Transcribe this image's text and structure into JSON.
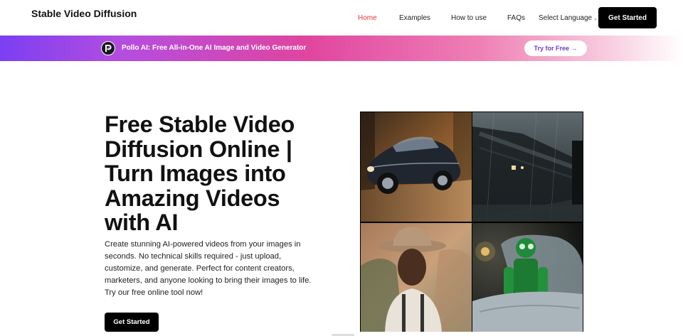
{
  "header": {
    "logo": "Stable Video Diffusion",
    "nav": [
      {
        "label": "Home",
        "active": true
      },
      {
        "label": "Examples",
        "active": false
      },
      {
        "label": "How to use",
        "active": false
      },
      {
        "label": "FAQs",
        "active": false
      }
    ],
    "language_label": "Select Language",
    "cta_label": "Get Started"
  },
  "banner": {
    "text": "Pollo AI: Free All-in-One AI Image and Video Generator",
    "button_label": "Try for Free →",
    "logo_letter": "P"
  },
  "hero": {
    "title": "Free Stable Video Diffusion Online | Turn Images into Amazing Videos with AI",
    "description": "Create stunning AI-powered videos from your images in seconds. No technical skills required - just upload, customize, and generate. Perfect for content creators, marketers, and anyone looking to bring their images to life. Try our free online tool now!",
    "cta_label": "Get Started"
  },
  "colors": {
    "active_nav": "#e53935",
    "button_bg": "#000000",
    "banner_start": "#7b3ff2",
    "banner_mid": "#e0459f"
  },
  "images": [
    {
      "name": "vintage-car"
    },
    {
      "name": "train-in-rain"
    },
    {
      "name": "cowboy-portrait"
    },
    {
      "name": "green-robot-in-bed"
    }
  ]
}
